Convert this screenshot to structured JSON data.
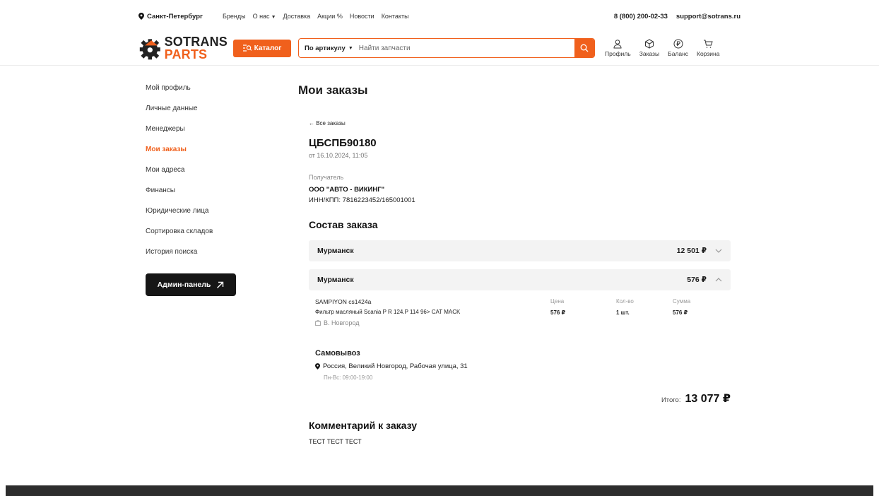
{
  "topbar": {
    "city": "Санкт-Петербург",
    "nav": [
      "Бренды",
      "О нас",
      "Доставка",
      "Акции",
      "Новости",
      "Контакты"
    ],
    "phone": "8 (800) 200-02-33",
    "email": "support@sotrans.ru"
  },
  "header": {
    "logo_line1": "SOTRANS",
    "logo_line2": "PARTS",
    "catalog_label": "Каталог",
    "search_type": "По артикулу",
    "search_placeholder": "Найти запчасти",
    "icons": {
      "profile": "Профиль",
      "orders": "Заказы",
      "balance": "Баланс",
      "cart": "Корзина"
    }
  },
  "sidebar": {
    "items": [
      {
        "label": "Мой профиль"
      },
      {
        "label": "Личные данные"
      },
      {
        "label": "Менеджеры"
      },
      {
        "label": "Мои заказы"
      },
      {
        "label": "Мои адреса"
      },
      {
        "label": "Финансы"
      },
      {
        "label": "Юридические лица"
      },
      {
        "label": "Сортировка складов"
      },
      {
        "label": "История поиска"
      }
    ],
    "admin_label": "Админ-панель"
  },
  "main": {
    "title": "Мои заказы",
    "back_link": "← Все заказы",
    "order_number": "ЦБСПБ90180",
    "order_date": "от 16.10.2024, 11:05",
    "recipient_label": "Получатель",
    "recipient_name": "ООО \"АВТО - ВИКИНГ\"",
    "recipient_inn": "ИНН/КПП: 7816223452/165001001",
    "composition_title": "Состав заказа",
    "warehouses": [
      {
        "name": "Мурманск",
        "sum": "12 501 ₽"
      },
      {
        "name": "Мурманск",
        "sum": "576 ₽"
      }
    ],
    "item": {
      "brand_code": "SAMPIYON   cs1424a",
      "name": "Фильтр масляный Scania P R 124.P 114 96> CAT MACK",
      "city": "В. Новгород",
      "price_label": "Цена",
      "price": "576 ₽",
      "qty_label": "Кол-во",
      "qty": "1 шт.",
      "sum_label": "Сумма",
      "sum": "576 ₽"
    },
    "pickup_title": "Самовывоз",
    "pickup_address": "Россия, Великий Новгород, Рабочая улица, 31",
    "pickup_hours": "Пн-Вс: 09:00-19:00",
    "total_label": "Итого:",
    "total_value": "13 077 ₽",
    "comment_title": "Комментарий к заказу",
    "comment_text": "ТЕСТ ТЕСТ ТЕСТ"
  },
  "colors": {
    "accent": "#f0601c",
    "dark": "#161616",
    "footer": "#2d2d2d"
  }
}
